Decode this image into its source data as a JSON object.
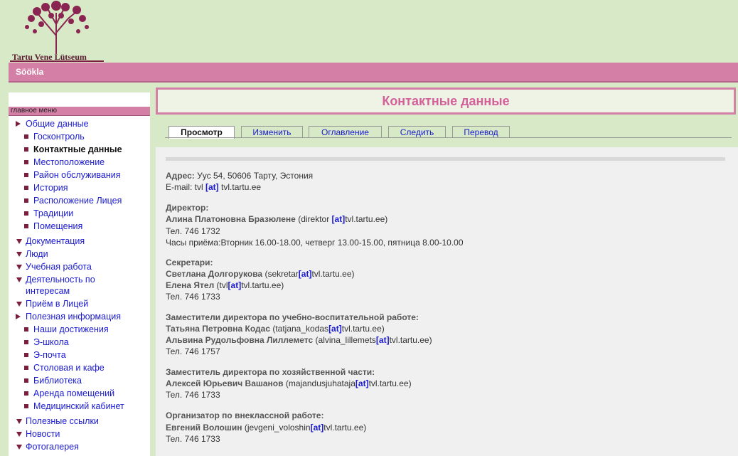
{
  "header": {
    "logo_text": "Tartu Vene Lütseum",
    "section": "Söökla"
  },
  "colors": {
    "accent": "#d47fa6",
    "background": "#d8e9c8",
    "link": "#1a1ad0",
    "dark": "#7a1f3d"
  },
  "sidebar": {
    "heading": "главное меню",
    "items": [
      {
        "label": "Общие данные"
      },
      {
        "label": "Госконтроль"
      },
      {
        "label": "Контактные данные"
      },
      {
        "label": "Местоположение"
      },
      {
        "label": "Район обслуживания"
      },
      {
        "label": "История"
      },
      {
        "label": "Расположение Лицея"
      },
      {
        "label": "Традиции"
      },
      {
        "label": "Помещения"
      },
      {
        "label": "Документация"
      },
      {
        "label": "Люди"
      },
      {
        "label": "Учебная работа"
      },
      {
        "label": "Деятельность по"
      },
      {
        "label": "интересам"
      },
      {
        "label": "Приём в Лицей"
      },
      {
        "label": "Полезная информация"
      },
      {
        "label": "Наши достижения"
      },
      {
        "label": "Э-школа"
      },
      {
        "label": "Э-почта"
      },
      {
        "label": "Столовая и кафе"
      },
      {
        "label": "Библиотека"
      },
      {
        "label": "Аренда помещений"
      },
      {
        "label": "Медицинский кабинет"
      },
      {
        "label": "Полезные ссылки"
      },
      {
        "label": "Новости"
      },
      {
        "label": "Фотогалерея"
      }
    ]
  },
  "main": {
    "title": "Контактные данные",
    "tabs": [
      {
        "label": "Просмотр"
      },
      {
        "label": "Изменить"
      },
      {
        "label": "Оглавление"
      },
      {
        "label": "Следить"
      },
      {
        "label": "Перевод"
      }
    ],
    "at": "[at]",
    "address_label": "Адрес:",
    "address": " Уус 54, 50606 Тарту, Эстония",
    "email_pre": "E-mail: tvl ",
    "email_post": " tvl.tartu.ee",
    "director_head": "Директор:",
    "director_name": "Алина Платоновна Бразюлене",
    "director_mail_pre": " (direktor ",
    "director_mail_post": "tvl.tartu.ee)",
    "director_tel": "Тел. 746 1732",
    "director_hours": "Часы приёма:Вторник 16.00-18.00, четверг 13.00-15.00, пятница 8.00-10.00",
    "secretaries_head": "Секретари:",
    "sec1_name": "Светлана Долгорукова",
    "sec1_mail_pre": " (sekretar",
    "sec1_mail_post": "tvl.tartu.ee)",
    "sec2_name": "Елена Ятел",
    "sec2_mail_pre": " (tvl",
    "sec2_mail_post": "tvl.tartu.ee)",
    "sec_tel": "Тел. 746 1733",
    "deputies_head": "Заместители директора по учебно-воспитательной работе:",
    "dep1_name": "Татьяна Петровна Кодас",
    "dep1_mail_pre": " (tatjana_kodas",
    "dep1_mail_post": "tvl.tartu.ee)",
    "dep2_name": "Альвина Рудольфовна Лиллеметс",
    "dep2_mail_pre": "  (alvina_lillemets",
    "dep2_mail_post": "tvl.tartu.ee)",
    "dep_tel": "Тел. 746 1757",
    "eco_head": "Заместитель директора по хозяйственной части:",
    "eco_name": "Алексей Юрьевич Вашанов",
    "eco_mail_pre": " (majandusjuhataja",
    "eco_mail_post": "tvl.tartu.ee)",
    "eco_tel": "Тел. 746 1733",
    "org_head": "Организатор по внеклассной работе:",
    "org_name": "Евгений Волошин",
    "org_mail_pre": " (jevgeni_voloshin",
    "org_mail_post": "tvl.tartu.ee)",
    "org_tel": "Тел. 746 1733"
  }
}
